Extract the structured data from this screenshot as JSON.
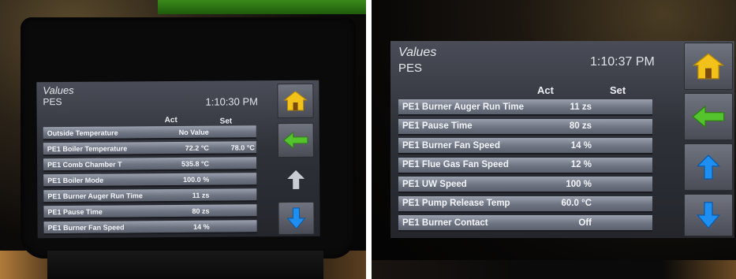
{
  "left_panel": {
    "title": "Values",
    "subtitle": "PES",
    "time": "1:10:30 PM",
    "col_act": "Act",
    "col_set": "Set",
    "rows": [
      {
        "label": "Outside Temperature",
        "act": "No Value",
        "set": ""
      },
      {
        "label": "PE1 Boiler Temperature",
        "act": "72.2 °C",
        "set": "78.0 °C"
      },
      {
        "label": "PE1 Comb Chamber T",
        "act": "535.8 °C",
        "set": ""
      },
      {
        "label": "PE1 Boiler Mode",
        "act": "100.0 %",
        "set": ""
      },
      {
        "label": "PE1 Burner Auger Run Time",
        "act": "11 zs",
        "set": ""
      },
      {
        "label": "PE1 Pause Time",
        "act": "80 zs",
        "set": ""
      },
      {
        "label": "PE1 Burner Fan Speed",
        "act": "14 %",
        "set": ""
      }
    ],
    "nav_icons": [
      "home-icon",
      "back-arrow-icon",
      "up-arrow-icon",
      "down-arrow-icon"
    ]
  },
  "right_panel": {
    "title": "Values",
    "subtitle": "PES",
    "time": "1:10:37 PM",
    "col_act": "Act",
    "col_set": "Set",
    "rows": [
      {
        "label": "PE1 Burner Auger Run Time",
        "act": "11 zs",
        "set": ""
      },
      {
        "label": "PE1 Pause Time",
        "act": "80 zs",
        "set": ""
      },
      {
        "label": "PE1 Burner Fan Speed",
        "act": "14 %",
        "set": ""
      },
      {
        "label": "PE1 Flue Gas Fan Speed",
        "act": "12 %",
        "set": ""
      },
      {
        "label": "PE1 UW Speed",
        "act": "100 %",
        "set": ""
      },
      {
        "label": "PE1 Pump Release Temp",
        "act": "60.0 °C",
        "set": ""
      },
      {
        "label": "PE1 Burner Contact",
        "act": "Off",
        "set": ""
      }
    ],
    "nav_icons": [
      "home-icon",
      "back-arrow-icon",
      "up-arrow-icon",
      "down-arrow-icon"
    ]
  },
  "colors": {
    "home": "#f2c21a",
    "back": "#55c32e",
    "up_disabled": "#c9ccd2",
    "arrow_blue": "#1e8ff0"
  }
}
